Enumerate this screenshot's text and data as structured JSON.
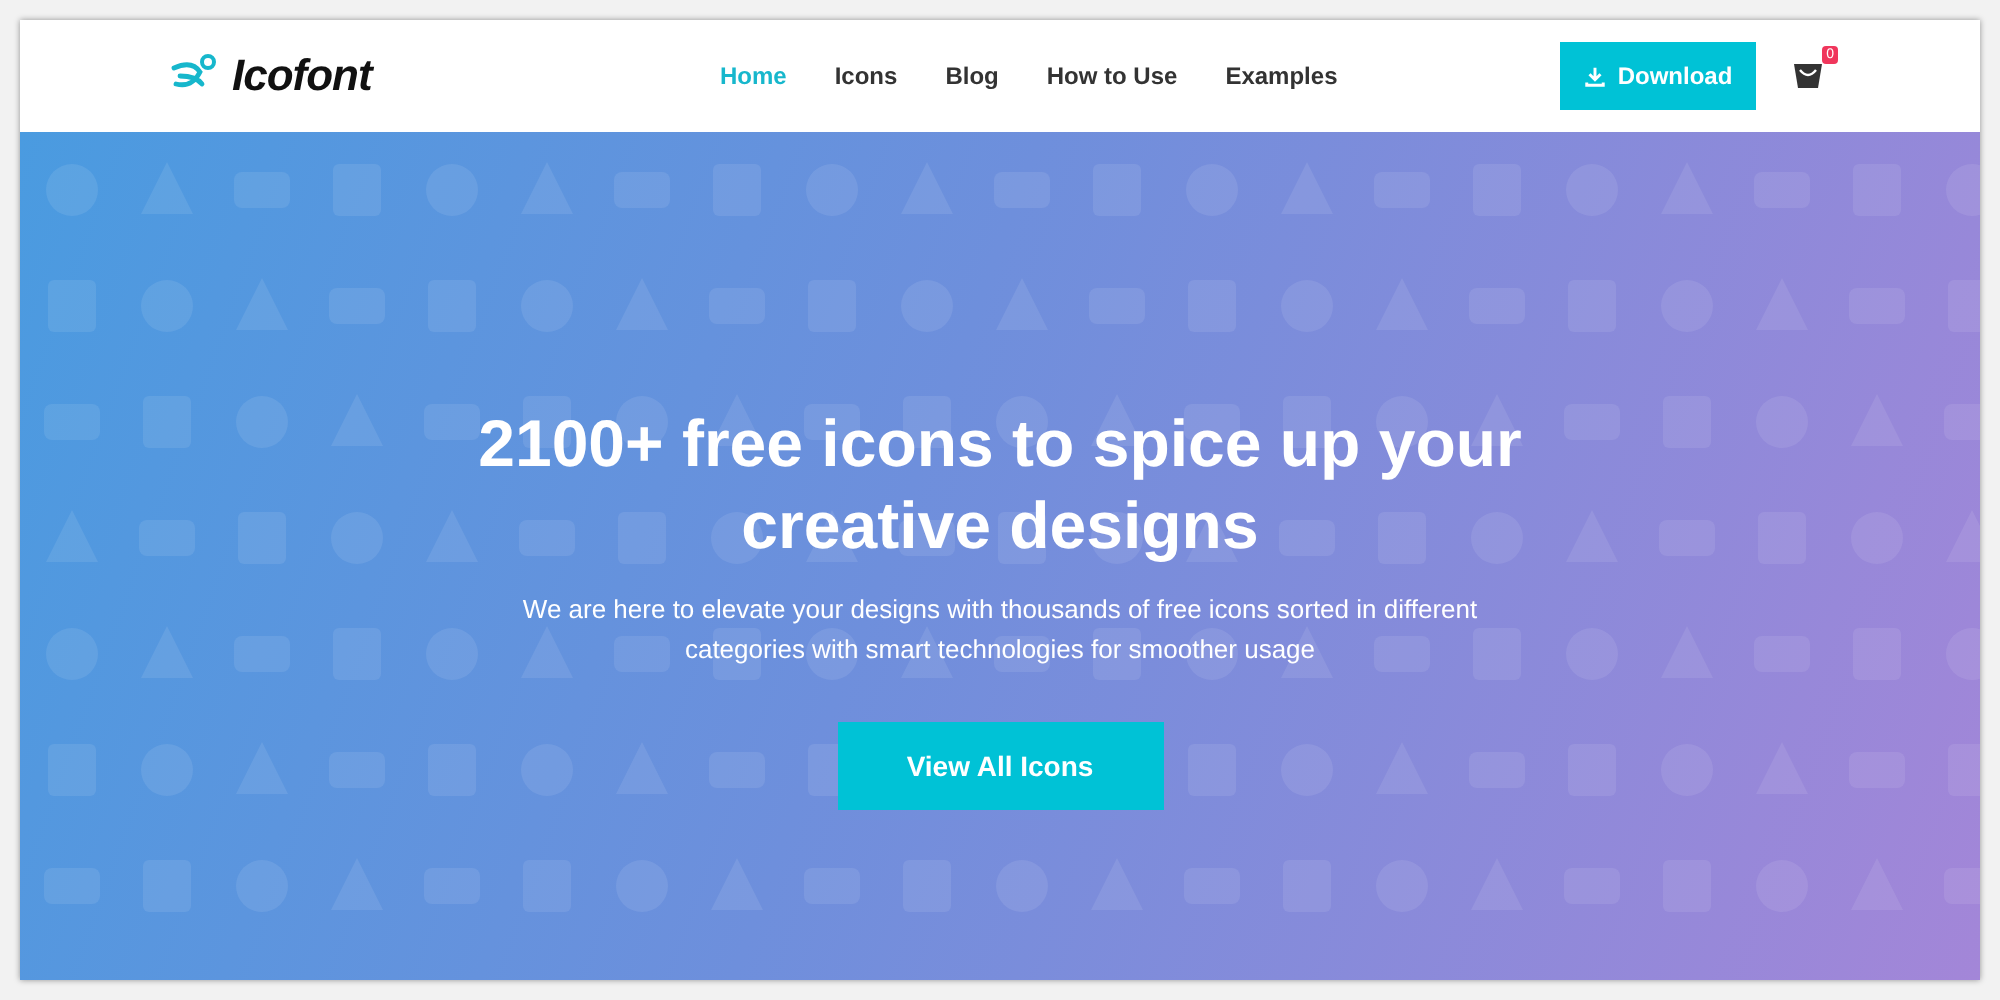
{
  "brand": {
    "name": "Icofont"
  },
  "nav": [
    {
      "label": "Home",
      "selected": true
    },
    {
      "label": "Icons",
      "selected": false
    },
    {
      "label": "Blog",
      "selected": false
    },
    {
      "label": "How to Use",
      "selected": false
    },
    {
      "label": "Examples",
      "selected": false
    }
  ],
  "download_button": {
    "label": "Download"
  },
  "cart": {
    "count": "0"
  },
  "hero": {
    "title": "2100+ free icons to spice up your creative designs",
    "subtitle": "We are here to elevate your designs with thousands of free icons sorted in different categories with smart technologies for smoother usage",
    "button": "View All Icons"
  }
}
